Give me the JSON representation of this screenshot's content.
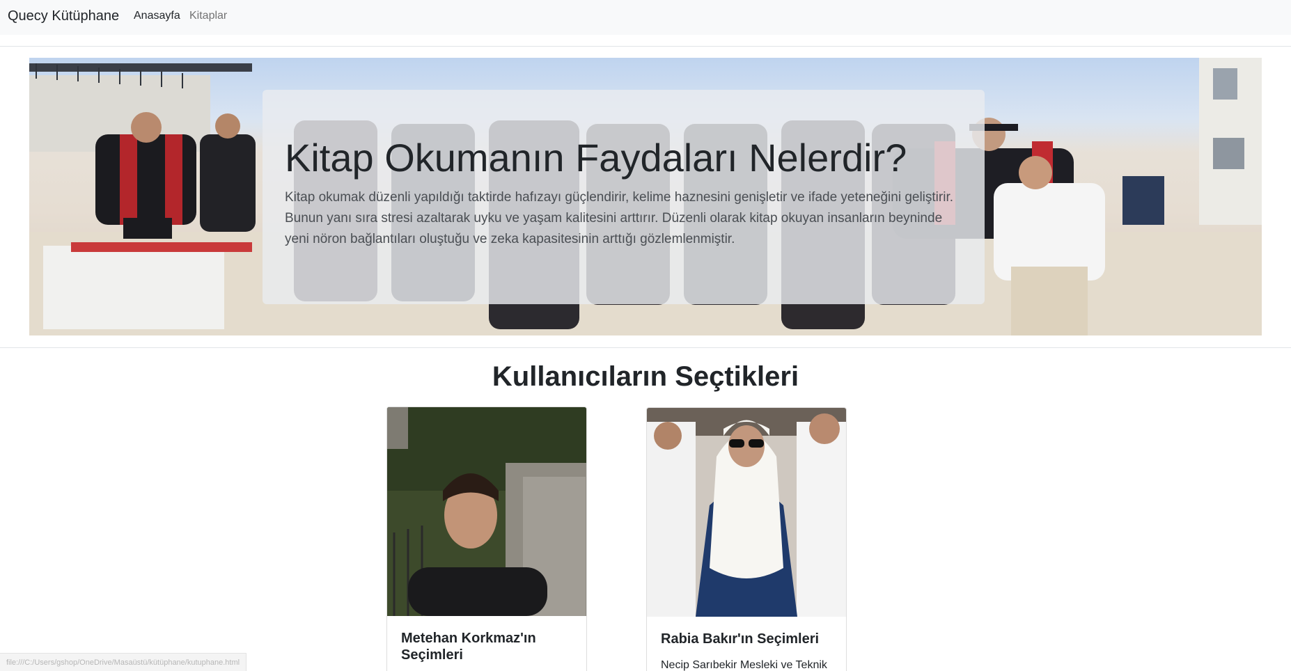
{
  "navbar": {
    "brand": "Quecy Kütüphane",
    "links": [
      {
        "label": "Anasayfa",
        "active": true
      },
      {
        "label": "Kitaplar",
        "active": false
      }
    ]
  },
  "hero": {
    "title": "Kitap Okumanın Faydaları Nelerdir?",
    "lead": "Kitap okumak düzenli yapıldığı taktirde hafızayı güçlendirir, kelime haznesini genişletir ve ifade yeteneğini geliştirir. Bunun yanı sıra stresi azaltarak uyku ve yaşam kalitesini arttırır. Düzenli olarak kitap okuyan insanların beyninde yeni nöron bağlantıları oluştuğu ve zeka kapasitesinin arttığı gözlemlenmiştir."
  },
  "section": {
    "title": "Kullanıcıların Seçtikleri"
  },
  "cards": [
    {
      "title": "Metehan Korkmaz'ın Seçimleri",
      "text": ""
    },
    {
      "title": "Rabia Bakır'ın Seçimleri",
      "text": "Necip Sarıbekir Mesleki ve Teknik"
    }
  ],
  "status_bar": {
    "url": "file:///C:/Users/gshop/OneDrive/Masaüstü/kütüphane/kutuphane.html"
  },
  "colors": {
    "navbar_bg": "#f8f9fa",
    "jumbotron_bg": "#e9ecef",
    "text": "#212529",
    "muted_link": "#8c8c8c"
  }
}
